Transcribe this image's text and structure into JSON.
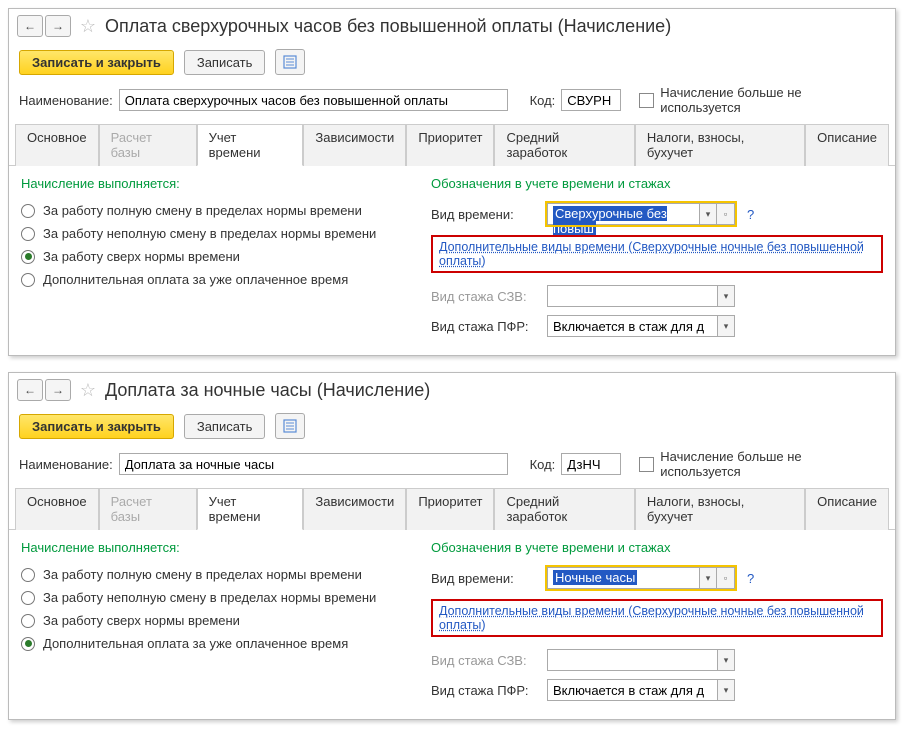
{
  "windows": [
    {
      "title": "Оплата сверхурочных часов без повышенной оплаты (Начисление)",
      "toolbar": {
        "save_close": "Записать и закрыть",
        "save": "Записать"
      },
      "name_label": "Наименование:",
      "name_value": "Оплата сверхурочных часов без повышенной оплаты",
      "code_label": "Код:",
      "code_value": "СВУРН",
      "not_used_label": "Начисление больше не используется",
      "tabs": [
        "Основное",
        "Расчет базы",
        "Учет времени",
        "Зависимости",
        "Приоритет",
        "Средний заработок",
        "Налоги, взносы, бухучет",
        "Описание"
      ],
      "active_tab": 2,
      "disabled_tab": 1,
      "left_head": "Начисление выполняется:",
      "radios": [
        "За работу полную смену в пределах нормы времени",
        "За работу неполную смену в пределах нормы времени",
        "За работу сверх нормы времени",
        "Дополнительная оплата за уже оплаченное время"
      ],
      "radio_checked": 2,
      "right_head": "Обозначения в учете времени и стажах",
      "time_kind_label": "Вид времени:",
      "time_kind_value": "Сверхурочные без повыш",
      "extra_link": "Дополнительные виды времени (Сверхурочные ночные без повышенной оплаты)",
      "szv_label": "Вид стажа СЗВ:",
      "szv_value": "",
      "pfr_label": "Вид стажа ПФР:",
      "pfr_value": "Включается в стаж для д"
    },
    {
      "title": "Доплата за ночные часы (Начисление)",
      "toolbar": {
        "save_close": "Записать и закрыть",
        "save": "Записать"
      },
      "name_label": "Наименование:",
      "name_value": "Доплата за ночные часы",
      "code_label": "Код:",
      "code_value": "ДзНЧ",
      "not_used_label": "Начисление больше не используется",
      "tabs": [
        "Основное",
        "Расчет базы",
        "Учет времени",
        "Зависимости",
        "Приоритет",
        "Средний заработок",
        "Налоги, взносы, бухучет",
        "Описание"
      ],
      "active_tab": 2,
      "disabled_tab": 1,
      "left_head": "Начисление выполняется:",
      "radios": [
        "За работу полную смену в пределах нормы времени",
        "За работу неполную смену в пределах нормы времени",
        "За работу сверх нормы времени",
        "Дополнительная оплата за уже оплаченное время"
      ],
      "radio_checked": 3,
      "right_head": "Обозначения в учете времени и стажах",
      "time_kind_label": "Вид времени:",
      "time_kind_value": "Ночные часы",
      "extra_link": "Дополнительные виды времени (Сверхурочные ночные без повышенной оплаты)",
      "szv_label": "Вид стажа СЗВ:",
      "szv_value": "",
      "pfr_label": "Вид стажа ПФР:",
      "pfr_value": "Включается в стаж для д"
    }
  ]
}
